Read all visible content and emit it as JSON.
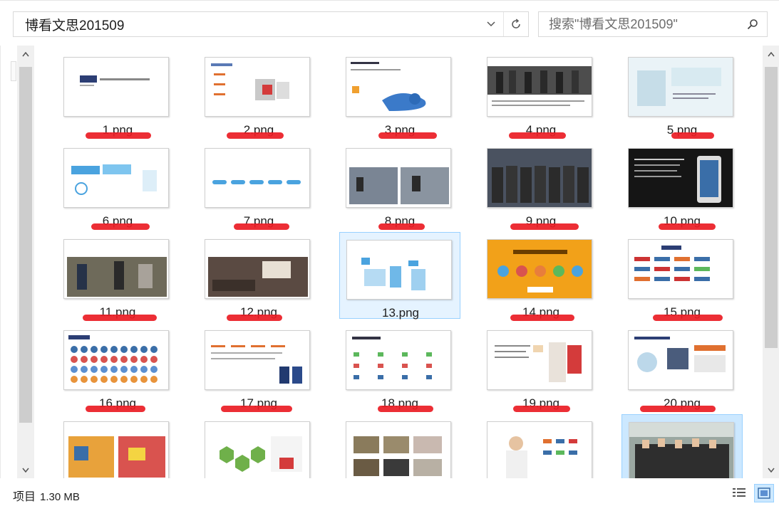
{
  "address": {
    "path": "博看文思201509",
    "dropdown_icon": "chevron-down-icon",
    "refresh_icon": "refresh-icon"
  },
  "search": {
    "placeholder": "搜索\"博看文思201509\"",
    "icon": "search-icon"
  },
  "files": [
    {
      "name": "1.png"
    },
    {
      "name": "2.png"
    },
    {
      "name": "3.png"
    },
    {
      "name": "4.png"
    },
    {
      "name": "5.png"
    },
    {
      "name": "6.png"
    },
    {
      "name": "7.png"
    },
    {
      "name": "8.png"
    },
    {
      "name": "9.png"
    },
    {
      "name": "10.png"
    },
    {
      "name": "11.png"
    },
    {
      "name": "12.png"
    },
    {
      "name": "13.png"
    },
    {
      "name": "14.png"
    },
    {
      "name": "15.png"
    },
    {
      "name": "16.png"
    },
    {
      "name": "17.png"
    },
    {
      "name": "18.png"
    },
    {
      "name": "19.png"
    },
    {
      "name": "20.png"
    },
    {
      "name": ""
    },
    {
      "name": ""
    },
    {
      "name": ""
    },
    {
      "name": ""
    },
    {
      "name": ""
    }
  ],
  "status": {
    "label": "项目",
    "size": "1.30 MB"
  },
  "colors": {
    "annotation_red": "#ea1c24",
    "selection": "#cce8ff",
    "selection_border": "#99d1ff"
  }
}
